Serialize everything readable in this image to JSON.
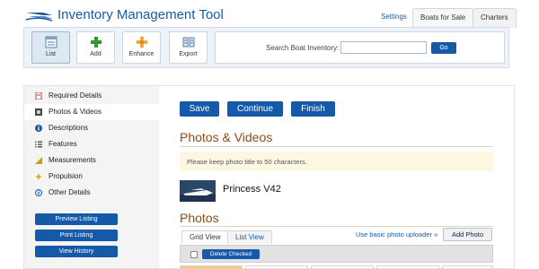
{
  "app": {
    "title": "Inventory Management Tool",
    "logo": "ship-logo-icon"
  },
  "top_nav": {
    "settings_label": "Settings",
    "tabs": [
      {
        "label": "Boats for Sale",
        "active": true
      },
      {
        "label": "Charters",
        "active": false
      }
    ]
  },
  "toolbar": {
    "buttons": [
      {
        "label": "List",
        "icon": "list-icon",
        "active": true
      },
      {
        "label": "Add",
        "icon": "plus-icon",
        "active": false
      },
      {
        "label": "Enhance",
        "icon": "enhance-icon",
        "active": false
      },
      {
        "label": "Export",
        "icon": "export-icon",
        "active": false
      }
    ],
    "search": {
      "label": "Search Boat Inventory:",
      "value": "",
      "button_label": "Go"
    }
  },
  "sidebar": {
    "items": [
      {
        "label": "Required Details",
        "icon": "document-icon",
        "active": false
      },
      {
        "label": "Photos & Videos",
        "icon": "film-icon",
        "active": true
      },
      {
        "label": "Descriptions",
        "icon": "info-icon",
        "active": false
      },
      {
        "label": "Features",
        "icon": "list-bullets-icon",
        "active": false
      },
      {
        "label": "Measurements",
        "icon": "ruler-icon",
        "active": false
      },
      {
        "label": "Propulsion",
        "icon": "propeller-icon",
        "active": false
      },
      {
        "label": "Other Details",
        "icon": "info-circle-icon",
        "active": false
      }
    ],
    "buttons": [
      {
        "label": "Preview Listing"
      },
      {
        "label": "Print Listing"
      },
      {
        "label": "View History"
      }
    ]
  },
  "main": {
    "actions": {
      "save": "Save",
      "continue": "Continue",
      "finish": "Finish"
    },
    "section_title": "Photos & Videos",
    "notice": "Please keep photo title to 50 characters.",
    "boat_name": "Princess V42",
    "photos_title": "Photos",
    "view_tabs": [
      {
        "label": "Grid View",
        "active": true
      },
      {
        "label": "List View",
        "active": false
      }
    ],
    "uploader_link": "Use basic photo uploader »",
    "add_photo": "Add Photo",
    "delete_checked": "Delete Checked"
  },
  "colors": {
    "brand_blue": "#1559a8",
    "title_brown": "#8a4e14",
    "notice_bg": "#fdf6e1"
  }
}
